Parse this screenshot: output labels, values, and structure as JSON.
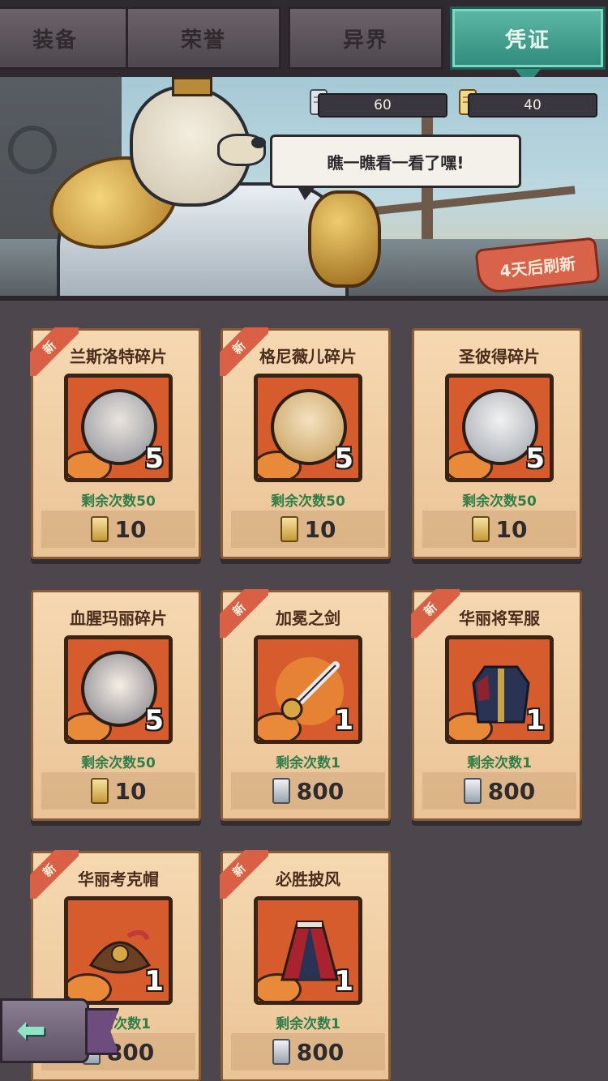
{
  "tabs": [
    {
      "label": "装备",
      "active": false
    },
    {
      "label": "荣誉",
      "active": false
    },
    {
      "label": "异界",
      "active": false
    },
    {
      "label": "凭证",
      "active": true
    }
  ],
  "resources": {
    "silver_ticket": "60",
    "gold_ticket": "40"
  },
  "speech": "瞧一瞧看一看了嘿!",
  "refresh_tag": "4天后刷新",
  "shop": {
    "items": [
      {
        "name": "兰斯洛特碎片",
        "badge": "新",
        "qty": "5",
        "remaining": "剩余次数50",
        "price": "10",
        "currency": "gold-ticket",
        "kind": "portrait"
      },
      {
        "name": "格尼薇儿碎片",
        "badge": "新",
        "qty": "5",
        "remaining": "剩余次数50",
        "price": "10",
        "currency": "gold-ticket",
        "kind": "portrait"
      },
      {
        "name": "圣彼得碎片",
        "badge": "",
        "qty": "5",
        "remaining": "剩余次数50",
        "price": "10",
        "currency": "gold-ticket",
        "kind": "portrait"
      },
      {
        "name": "血腥玛丽碎片",
        "badge": "",
        "qty": "5",
        "remaining": "剩余次数50",
        "price": "10",
        "currency": "gold-ticket",
        "kind": "portrait"
      },
      {
        "name": "加冕之剑",
        "badge": "新",
        "qty": "1",
        "remaining": "剩余次数1",
        "price": "800",
        "currency": "silver-ticket",
        "kind": "item"
      },
      {
        "name": "华丽将军服",
        "badge": "新",
        "qty": "1",
        "remaining": "剩余次数1",
        "price": "800",
        "currency": "silver-ticket",
        "kind": "item"
      },
      {
        "name": "华丽考克帽",
        "badge": "新",
        "qty": "1",
        "remaining": "剩余次数1",
        "price": "800",
        "currency": "silver-ticket",
        "kind": "item"
      },
      {
        "name": "必胜披风",
        "badge": "新",
        "qty": "1",
        "remaining": "剩余次数1",
        "price": "800",
        "currency": "silver-ticket",
        "kind": "item"
      }
    ]
  },
  "icons": {
    "back": "back-arrow-icon",
    "silver": "silver-ticket-icon",
    "gold": "gold-ticket-icon"
  }
}
